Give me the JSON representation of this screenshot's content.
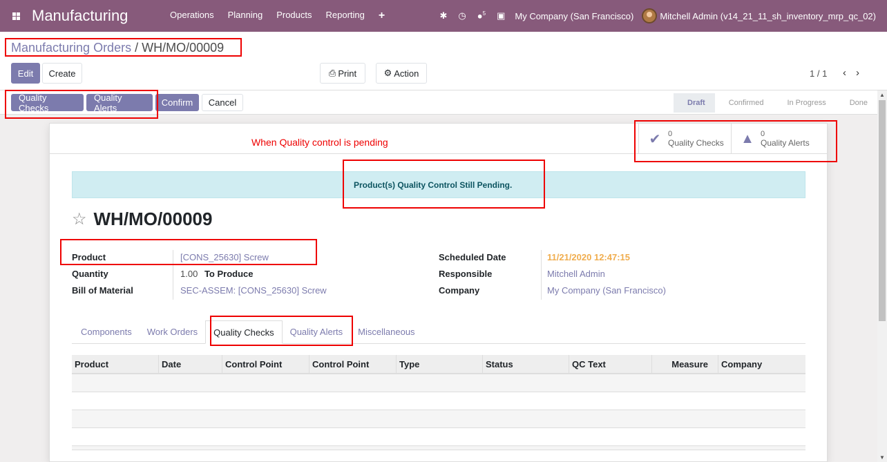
{
  "navbar": {
    "app_title": "Manufacturing",
    "menu": [
      "Operations",
      "Planning",
      "Products",
      "Reporting"
    ],
    "add_icon": "plus-icon",
    "messages_count": "5",
    "company": "My Company (San Francisco)",
    "user": "Mitchell Admin (v14_21_11_sh_inventory_mrp_qc_02)",
    "bg_color": "#875a7b"
  },
  "breadcrumb": {
    "parent": "Manufacturing Orders",
    "separator": "/",
    "current": "WH/MO/00009"
  },
  "toolbar": {
    "edit_label": "Edit",
    "create_label": "Create",
    "print_label": "Print",
    "action_label": "Action",
    "pager": "1 / 1"
  },
  "statusbar": {
    "buttons": [
      "Quality Checks",
      "Quality Alerts",
      "Confirm",
      "Cancel"
    ],
    "stages": [
      "Draft",
      "Confirmed",
      "In Progress",
      "Done"
    ],
    "active_stage": "Draft"
  },
  "sheet": {
    "note": "When Quality control is pending",
    "stat_checks": {
      "count": "0",
      "label": "Quality Checks"
    },
    "stat_alerts": {
      "count": "0",
      "label": "Quality Alerts"
    },
    "alert": "Product(s) Quality Control Still Pending.",
    "title": "WH/MO/00009",
    "fields": {
      "product_label": "Product",
      "product_value": "[CONS_25630] Screw",
      "quantity_label": "Quantity",
      "quantity_value": "1.00",
      "quantity_suffix": "To Produce",
      "bom_label": "Bill of Material",
      "bom_value": "SEC-ASSEM: [CONS_25630] Screw",
      "scheduled_label": "Scheduled Date",
      "scheduled_value": "11/21/2020 12:47:15",
      "responsible_label": "Responsible",
      "responsible_value": "Mitchell Admin",
      "company_label": "Company",
      "company_value": "My Company (San Francisco)"
    },
    "tabs": [
      "Components",
      "Work Orders",
      "Quality Checks",
      "Quality Alerts",
      "Miscellaneous"
    ],
    "active_tab": "Quality Checks",
    "table_headers": [
      "Product",
      "Date",
      "Control Point",
      "Control Point",
      "Type",
      "Status",
      "QC Text",
      "Measure",
      "Company"
    ]
  }
}
